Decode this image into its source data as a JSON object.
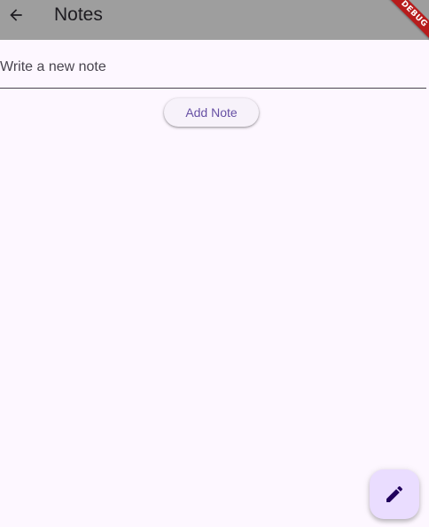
{
  "app_bar": {
    "title": "Notes",
    "back_icon": "arrow-back-icon",
    "background_color": "#9e9e9e"
  },
  "debug_banner": {
    "label": "DEBUG",
    "color": "#b71c1c"
  },
  "note_input": {
    "value": "",
    "placeholder": "Write a new note"
  },
  "add_button": {
    "label": "Add Note",
    "text_color": "#6750a4"
  },
  "fab": {
    "icon": "edit-pencil-icon",
    "background_color": "#eaddff",
    "icon_color": "#21005d"
  },
  "theme": {
    "page_background": "#fdf7ff"
  }
}
